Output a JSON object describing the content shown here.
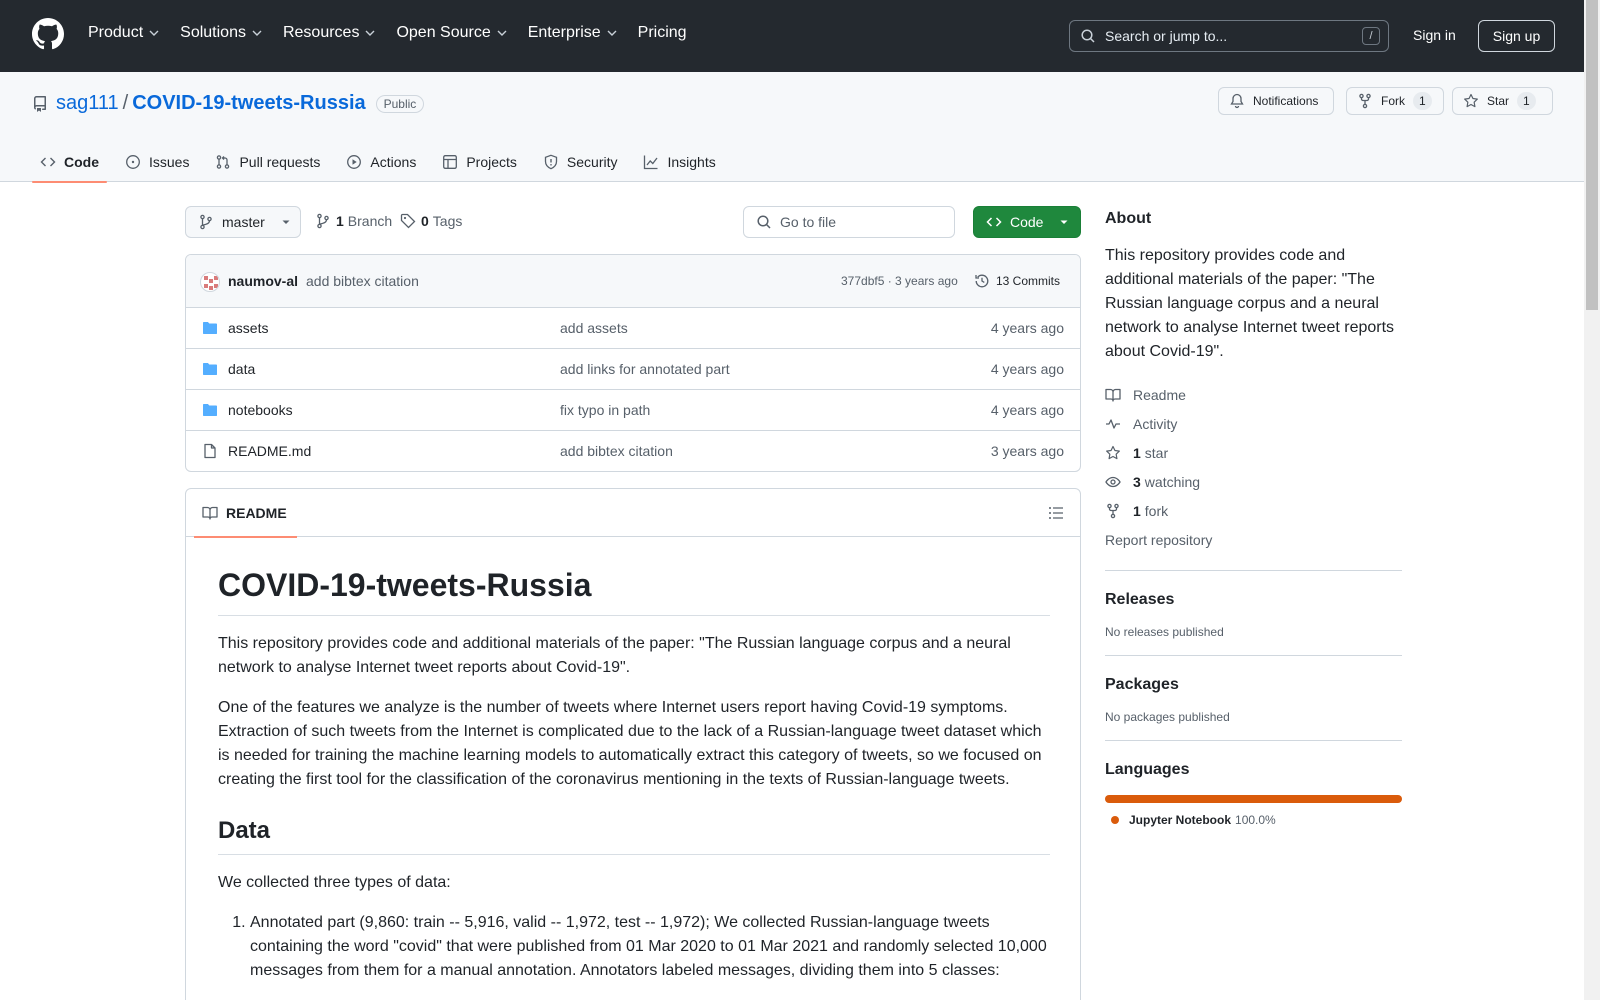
{
  "topnav": {
    "items": [
      {
        "label": "Product",
        "dropdown": true
      },
      {
        "label": "Solutions",
        "dropdown": true
      },
      {
        "label": "Resources",
        "dropdown": true
      },
      {
        "label": "Open Source",
        "dropdown": true
      },
      {
        "label": "Enterprise",
        "dropdown": true
      },
      {
        "label": "Pricing",
        "dropdown": false
      }
    ],
    "search_placeholder": "Search or jump to...",
    "search_shortcut": "/",
    "signin": "Sign in",
    "signup": "Sign up"
  },
  "repo": {
    "owner": "sag111",
    "separator": "/",
    "name": "COVID-19-tweets-Russia",
    "visibility": "Public",
    "notifications_label": "Notifications",
    "fork_label": "Fork",
    "fork_count": "1",
    "star_label": "Star",
    "star_count": "1"
  },
  "tabs": [
    {
      "label": "Code",
      "icon": "code-icon",
      "active": true
    },
    {
      "label": "Issues",
      "icon": "issue-icon"
    },
    {
      "label": "Pull requests",
      "icon": "pull-request-icon"
    },
    {
      "label": "Actions",
      "icon": "play-icon"
    },
    {
      "label": "Projects",
      "icon": "table-icon"
    },
    {
      "label": "Security",
      "icon": "shield-icon"
    },
    {
      "label": "Insights",
      "icon": "graph-icon"
    }
  ],
  "branchbar": {
    "branch": "master",
    "branch_count": "1",
    "branch_label": "Branch",
    "tag_count": "0",
    "tag_label": "Tags",
    "goto_placeholder": "Go to file",
    "code_button": "Code"
  },
  "latest_commit": {
    "author": "naumov-al",
    "message": "add bibtex citation",
    "meta": "377dbf5 · 3 years ago",
    "commits_label": "13 Commits"
  },
  "files": [
    {
      "name": "assets",
      "type": "folder",
      "message": "add assets",
      "age": "4 years ago"
    },
    {
      "name": "data",
      "type": "folder",
      "message": "add links for annotated part",
      "age": "4 years ago"
    },
    {
      "name": "notebooks",
      "type": "folder",
      "message": "fix typo in path",
      "age": "4 years ago"
    },
    {
      "name": "README.md",
      "type": "file",
      "message": "add bibtex citation",
      "age": "3 years ago"
    }
  ],
  "readme": {
    "tab_label": "README",
    "h1": "COVID-19-tweets-Russia",
    "p1": "This repository provides code and additional materials of the paper: \"The Russian language corpus and a neural network to analyse Internet tweet reports about Covid-19\".",
    "p2": "One of the features we analyze is the number of tweets where Internet users report having Covid-19 symptoms. Extraction of such tweets from the Internet is complicated due to the lack of a Russian-language tweet dataset which is needed for training the machine learning models to automatically extract this category of tweets, so we focused on creating the first tool for the classification of the coronavirus mentioning in the texts of Russian-language tweets.",
    "h2": "Data",
    "p3": "We collected three types of data:",
    "li1": "Annotated part (9,860: train -- 5,916, valid -- 1,972, test -- 1,972); We collected Russian-language tweets containing the word \"covid\" that were published from 01 Mar 2020 to 01 Mar 2021 and randomly selected 10,000 messages from them for a manual annotation. Annotators labeled messages, dividing them into 5 classes:"
  },
  "sidebar": {
    "about_title": "About",
    "about_desc": "This repository provides code and additional materials of the paper: \"The Russian language corpus and a neural network to analyse Internet tweet reports about Covid-19\".",
    "readme_link": "Readme",
    "activity_link": "Activity",
    "stars_count": "1",
    "stars_label": "star",
    "watching_count": "3",
    "watching_label": "watching",
    "forks_count": "1",
    "forks_label": "fork",
    "report": "Report repository",
    "releases_title": "Releases",
    "releases_text": "No releases published",
    "packages_title": "Packages",
    "packages_text": "No packages published",
    "languages_title": "Languages",
    "language_name": "Jupyter Notebook",
    "language_pct": "100.0%",
    "language_share": 1.0,
    "language_color": "#DA5B0B"
  },
  "colors": {
    "header_bg": "#24292f",
    "link": "#0969da",
    "code_button": "#1f883d",
    "tab_underline": "#fd8c73"
  }
}
